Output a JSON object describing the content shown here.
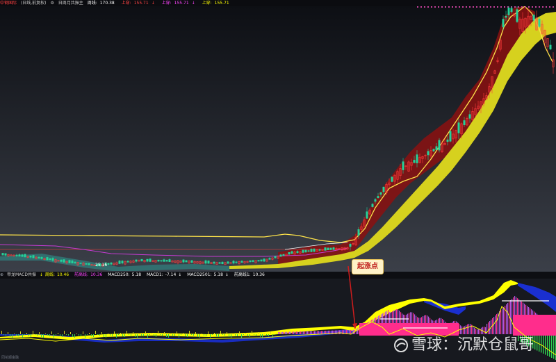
{
  "header": {
    "security_name": "中钢国际",
    "period": "(日线,前复权)",
    "indicator": "日周月共振主",
    "items": [
      {
        "label": "周线:",
        "value": "170.38",
        "color": "#ffffff"
      },
      {
        "label": "上穿:",
        "value": "155.71",
        "color": "#ff4444"
      },
      {
        "label": "上穿:",
        "value": "155.71",
        "color": "#ff44ff"
      },
      {
        "label": "上穿:",
        "value": "155.71",
        "color": "#ffff00"
      }
    ]
  },
  "macd_header": {
    "name": "帝龙MACD共振",
    "items": [
      {
        "label": "周线:",
        "value": "10.46",
        "color": "#ffff00"
      },
      {
        "label": "前高线:",
        "value": "10.36",
        "color": "#ff44ff"
      },
      {
        "label": "MACD250:",
        "value": "5.18",
        "color": "#ffffff"
      },
      {
        "label": "MACD1:",
        "value": "-7.14",
        "color": "#ffffff"
      },
      {
        "label": "MACD2501:",
        "value": "5.18",
        "color": "#ffffff"
      },
      {
        "label": "前高线1:",
        "value": "10.36",
        "color": "#ffffff"
      }
    ]
  },
  "price_label": "25.16",
  "callout_text": "起涨点",
  "bottom_label": "同花顺金融",
  "watermark": {
    "text": "雪球：沉默仓鼠哥",
    "icon": "snowball-logo-icon"
  },
  "colors": {
    "bull": "#ff3b3b",
    "bear": "#24d39a",
    "band": "#d6d11e",
    "red_band": "#8b1010",
    "macd_area": "#ffff00",
    "macd_neg": "#1a2fd0",
    "hist_pink": "#ff2d8c"
  }
}
